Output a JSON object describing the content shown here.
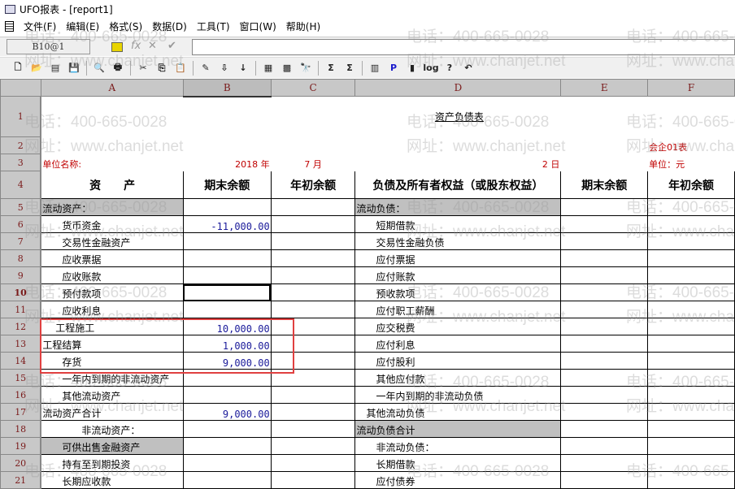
{
  "window": {
    "title": "UFO报表 - [report1]"
  },
  "menu": [
    "文件(F)",
    "编辑(E)",
    "格式(S)",
    "数据(D)",
    "工具(T)",
    "窗口(W)",
    "帮助(H)"
  ],
  "formula_bar": {
    "cell_ref": "B10@1",
    "fx": "fx",
    "cancel": "✕",
    "confirm": "✔",
    "value": ""
  },
  "toolbar_icons": [
    "new-icon",
    "open-icon",
    "blank-icon",
    "save-icon",
    "print-preview-icon",
    "print-icon",
    "cut-icon",
    "copy-icon",
    "paste-icon",
    "format-brush-icon",
    "insert-icon",
    "sort-icon",
    "merge-icon",
    "grid-icon",
    "find-icon",
    "sum-icon",
    "column-sum-icon",
    "chart-icon",
    "p-icon",
    "pin-icon",
    "log-icon",
    "help-icon",
    "undo-icon"
  ],
  "columns": [
    "A",
    "B",
    "C",
    "D",
    "E",
    "F"
  ],
  "sheet": {
    "title": "资产负债表",
    "form_no": "会企01表",
    "unit_name_label": "单位名称:",
    "year": "2018 年",
    "month": "7 月",
    "day": "2 日",
    "currency": "单位：元",
    "headers": [
      "资　　产",
      "期末余额",
      "年初余额",
      "负债及所有者权益（或股东权益）",
      "期末余额",
      "年初余额"
    ],
    "rows": [
      {
        "n": "5",
        "a": "流动资产：",
        "b": "",
        "d": "流动负债：",
        "a_shade": true,
        "d_shade": true
      },
      {
        "n": "6",
        "a": "　　货币资金",
        "b": "-11,000.00",
        "d": "　　短期借款"
      },
      {
        "n": "7",
        "a": "　　交易性金融资产",
        "b": "",
        "d": "　　交易性金融负债"
      },
      {
        "n": "8",
        "a": "　　应收票据",
        "b": "",
        "d": "　　应付票据"
      },
      {
        "n": "9",
        "a": "　　应收账款",
        "b": "",
        "d": "　　应付账款"
      },
      {
        "n": "10",
        "a": "　　预付款项",
        "b": "",
        "d": "　　预收款项",
        "selected": true
      },
      {
        "n": "11",
        "a": "　　应收利息",
        "b": "",
        "d": "　　应付职工薪酬"
      },
      {
        "n": "12",
        "a": "　 工程施工",
        "b": "10,000.00",
        "d": "　　应交税费"
      },
      {
        "n": "13",
        "a": "工程结算",
        "b": "1,000.00",
        "d": "　　应付利息"
      },
      {
        "n": "14",
        "a": "　　存货",
        "b": "9,000.00",
        "d": "　　应付股利"
      },
      {
        "n": "15",
        "a": "　　一年内到期的非流动资产",
        "b": "",
        "d": "　　其他应付款"
      },
      {
        "n": "16",
        "a": "　　其他流动资产",
        "b": "",
        "d": "　　一年内到期的非流动负债"
      },
      {
        "n": "17",
        "a": "流动资产合计",
        "b": "9,000.00",
        "d": "　其他流动负债"
      },
      {
        "n": "18",
        "a": "　　　　非流动资产：",
        "b": "",
        "d": "流动负债合计",
        "d_shade": true
      },
      {
        "n": "19",
        "a": "　　可供出售金融资产",
        "b": "",
        "d": "　　非流动负债：",
        "a_shade": true
      },
      {
        "n": "20",
        "a": "　　持有至到期投资",
        "b": "",
        "d": "　　长期借款"
      },
      {
        "n": "21",
        "a": "　　长期应收款",
        "b": "",
        "d": "　　应付债券"
      }
    ]
  },
  "watermark": {
    "phone": "电话：400-665-0028",
    "site": "网址：www.chanjet.net"
  }
}
